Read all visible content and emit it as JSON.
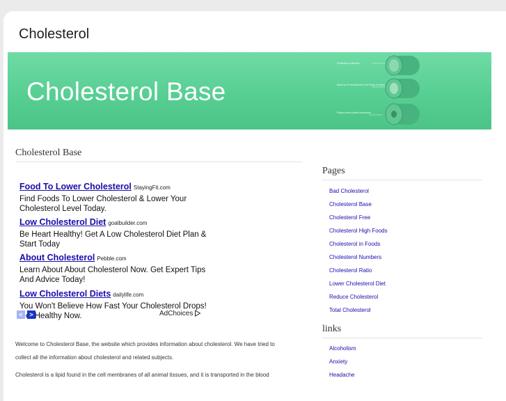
{
  "site": {
    "title": "Cholesterol"
  },
  "banner": {
    "title": "Cholesterol Base",
    "diagram_labels": [
      "Cholesterol particles",
      "Build-up of cholesterol in the lining of artery",
      "Plaque forms (atherosclerosis)",
      "Artery"
    ]
  },
  "main": {
    "heading": "Cholesterol Base",
    "ads": [
      {
        "title": "Food To Lower Cholesterol",
        "domain": "StayingFit.com",
        "desc": "Find Foods To Lower Cholesterol & Lower Your Cholesterol Level Today."
      },
      {
        "title": "Low Cholesterol Diet",
        "domain": "goalbuilder.com",
        "desc": "Be Heart Healthy! Get A Low Cholesterol Diet Plan & Start Today"
      },
      {
        "title": "About Cholesterol",
        "domain": "Pebble.com",
        "desc": "Learn About About Cholesterol Now. Get Expert Tips And Advice Today!"
      },
      {
        "title": "Low Cholesterol Diets",
        "domain": "dailylife.com",
        "desc": "You Won't Believe How Fast Your Cholesterol Drops! Get Healthy Now."
      }
    ],
    "ad_nav": {
      "prev": "<",
      "next": ">"
    },
    "adchoices": "AdChoices",
    "paragraphs": [
      "Welcome to Cholesterol Base, the website which provides information about cholesterol. We have tried to",
      "collect all the information about cholesterol and related subjects.",
      "Cholesterol is a lipid found in the cell membranes of all animal tissues, and it is transported in the blood"
    ]
  },
  "sidebar": {
    "pages_heading": "Pages",
    "pages": [
      "Bad Cholesterol",
      "Cholesterol Base",
      "Cholesterol Free",
      "Cholesterol High Foods",
      "Cholesterol in Foods",
      "Cholesterol Numbers",
      "Cholesterol Ratio",
      "Lower Cholesterol Diet",
      "Reduce Cholesterol",
      "Total Cholesterol"
    ],
    "links_heading": "links",
    "links": [
      "Alcoholism",
      "Anxiety",
      "Headache"
    ]
  },
  "colors": {
    "banner": "#57cf93",
    "link": "#1a0dab",
    "page_bg": "#ebebeb"
  }
}
